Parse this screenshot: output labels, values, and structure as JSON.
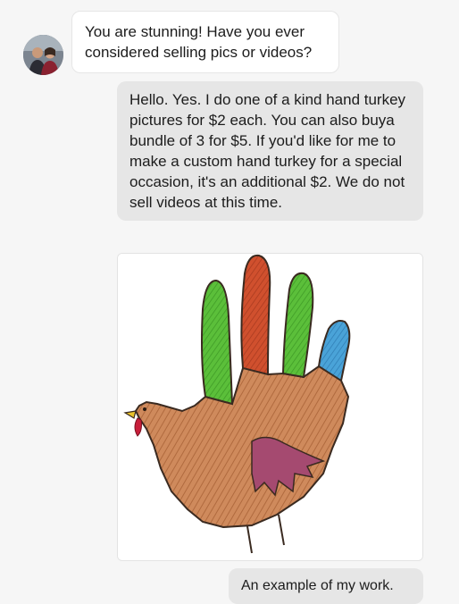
{
  "messages": {
    "incoming_text": "You are stunning! Have you ever considered selling pics or videos?",
    "reply_text": "Hello. Yes. I do one of a kind hand turkey pictures for $2 each. You can also buya bundle of 3 for $5. If you'd like for me to make a custom hand turkey for a special occasion, it's an additional $2. We do not sell videos at this time.",
    "caption_text": "An example of my work."
  },
  "icons": {
    "avatar": "profile-photo",
    "attachment": "hand-turkey-drawing"
  },
  "colors": {
    "background": "#f6f6f6",
    "incoming_bubble": "#ffffff",
    "outgoing_bubble": "#e6e6e6"
  }
}
